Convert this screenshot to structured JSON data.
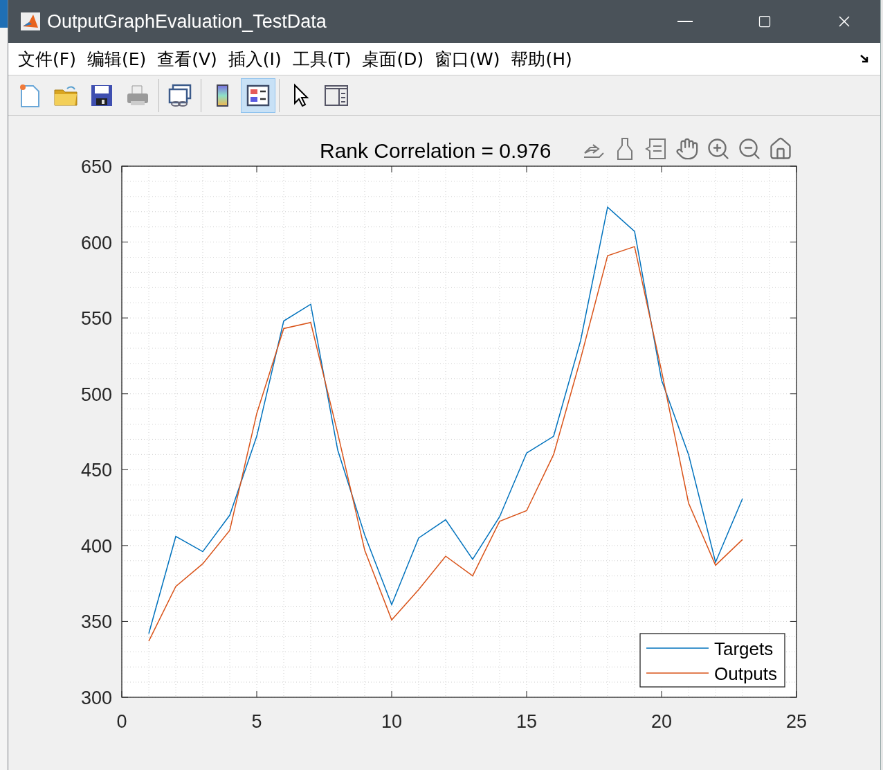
{
  "window": {
    "title": "OutputGraphEvaluation_TestData"
  },
  "menu": [
    "文件(F)",
    "编辑(E)",
    "查看(V)",
    "插入(I)",
    "工具(T)",
    "桌面(D)",
    "窗口(W)",
    "帮助(H)"
  ],
  "toolbar": [
    {
      "selected": false
    },
    {
      "selected": false
    },
    {
      "selected": false
    },
    {
      "selected": false
    },
    {
      "selected": false
    },
    {
      "selected": false
    },
    {
      "selected": true
    },
    {
      "selected": false
    },
    {
      "selected": false
    }
  ],
  "chart_data": {
    "type": "line",
    "title": "Rank Correlation = 0.976",
    "x": [
      1,
      2,
      3,
      4,
      5,
      6,
      7,
      8,
      9,
      10,
      11,
      12,
      13,
      14,
      15,
      16,
      17,
      18,
      19,
      20,
      21,
      22,
      23
    ],
    "series": [
      {
        "name": "Targets",
        "color": "#0072bd",
        "values": [
          342,
          406,
          396,
          420,
          472,
          548,
          559,
          463,
          407,
          361,
          405,
          417,
          391,
          419,
          461,
          472,
          535,
          623,
          607,
          509,
          460,
          389,
          431
        ]
      },
      {
        "name": "Outputs",
        "color": "#d95319",
        "values": [
          337,
          373,
          388,
          410,
          487,
          543,
          547,
          474,
          397,
          351,
          371,
          393,
          380,
          416,
          423,
          460,
          523,
          591,
          597,
          515,
          428,
          387,
          404
        ]
      }
    ],
    "grid": true,
    "legend": true,
    "xlim": [
      0,
      25
    ],
    "ylim": [
      300,
      650
    ],
    "xticks": [
      0,
      5,
      10,
      15,
      20,
      25
    ],
    "yticks": [
      300,
      350,
      400,
      450,
      500,
      550,
      600,
      650
    ]
  }
}
